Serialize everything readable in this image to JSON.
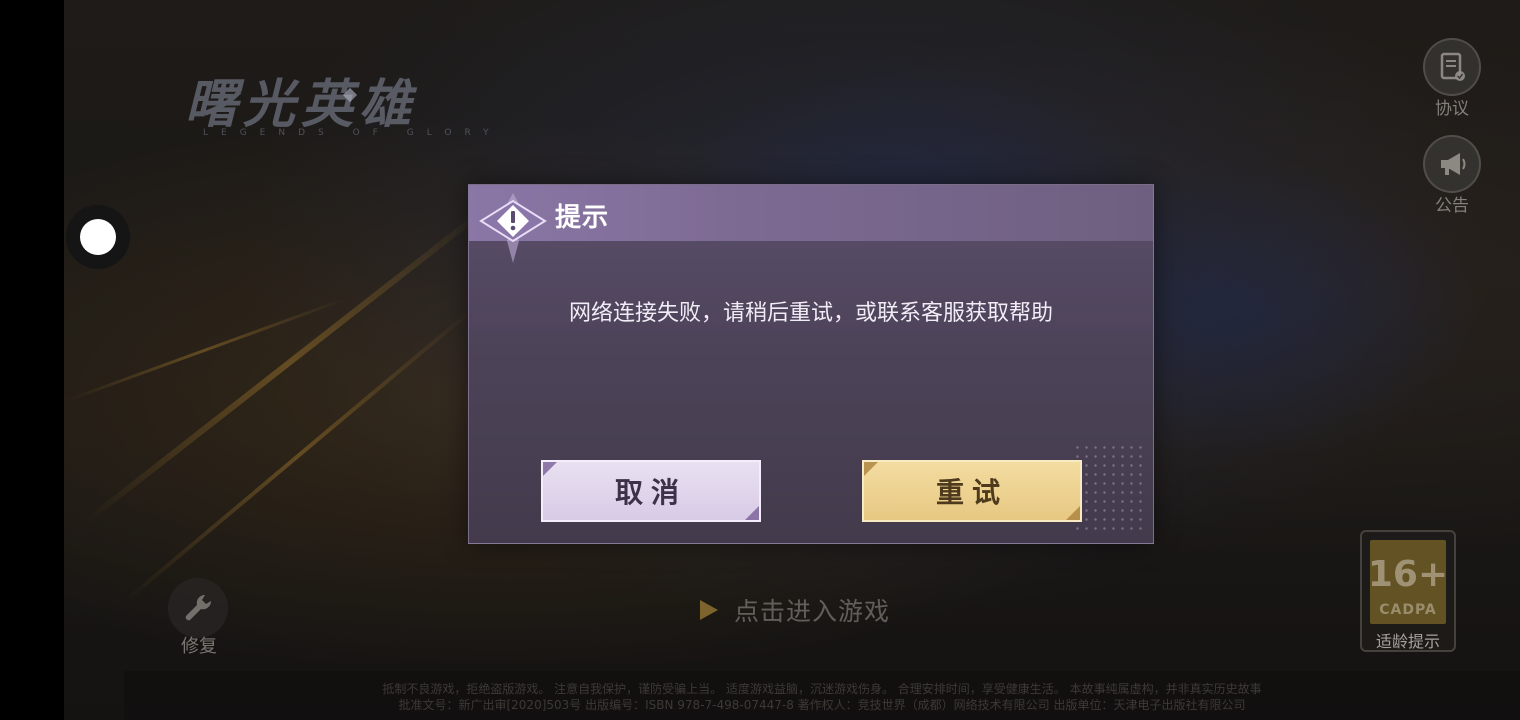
{
  "game": {
    "logo_title": "曙光英雄",
    "logo_subtitle": "LEGENDS OF GLORY"
  },
  "side_buttons": {
    "agreement_label": "协议",
    "notice_label": "公告",
    "repair_label": "修复"
  },
  "enter_game_text": "点击进入游戏",
  "age_rating": {
    "age": "16+",
    "org": "CADPA",
    "label": "适龄提示"
  },
  "footer": {
    "line1": "抵制不良游戏，拒绝盗版游戏。 注意自我保护，谨防受骗上当。 适度游戏益脑，沉迷游戏伤身。 合理安排时间，享受健康生活。 本故事纯属虚构，并非真实历史故事",
    "line2": "批准文号：新广出审[2020]503号  出版编号：ISBN 978-7-498-07447-8  著作权人：竞技世界（成都）网络技术有限公司  出版单位：天津电子出版社有限公司"
  },
  "dialog": {
    "title": "提示",
    "message": "网络连接失败，请稍后重试，或联系客服获取帮助",
    "cancel_label": "取消",
    "retry_label": "重试"
  },
  "colors": {
    "dialog_bg": "#4d4359",
    "dialog_header": "#8b77a6",
    "cancel_button": "#e0d5ec",
    "retry_button": "#edd290"
  },
  "icons": {
    "agreement": "document-check-icon",
    "notice": "megaphone-icon",
    "repair": "wrench-icon",
    "warning": "warning-icon"
  }
}
